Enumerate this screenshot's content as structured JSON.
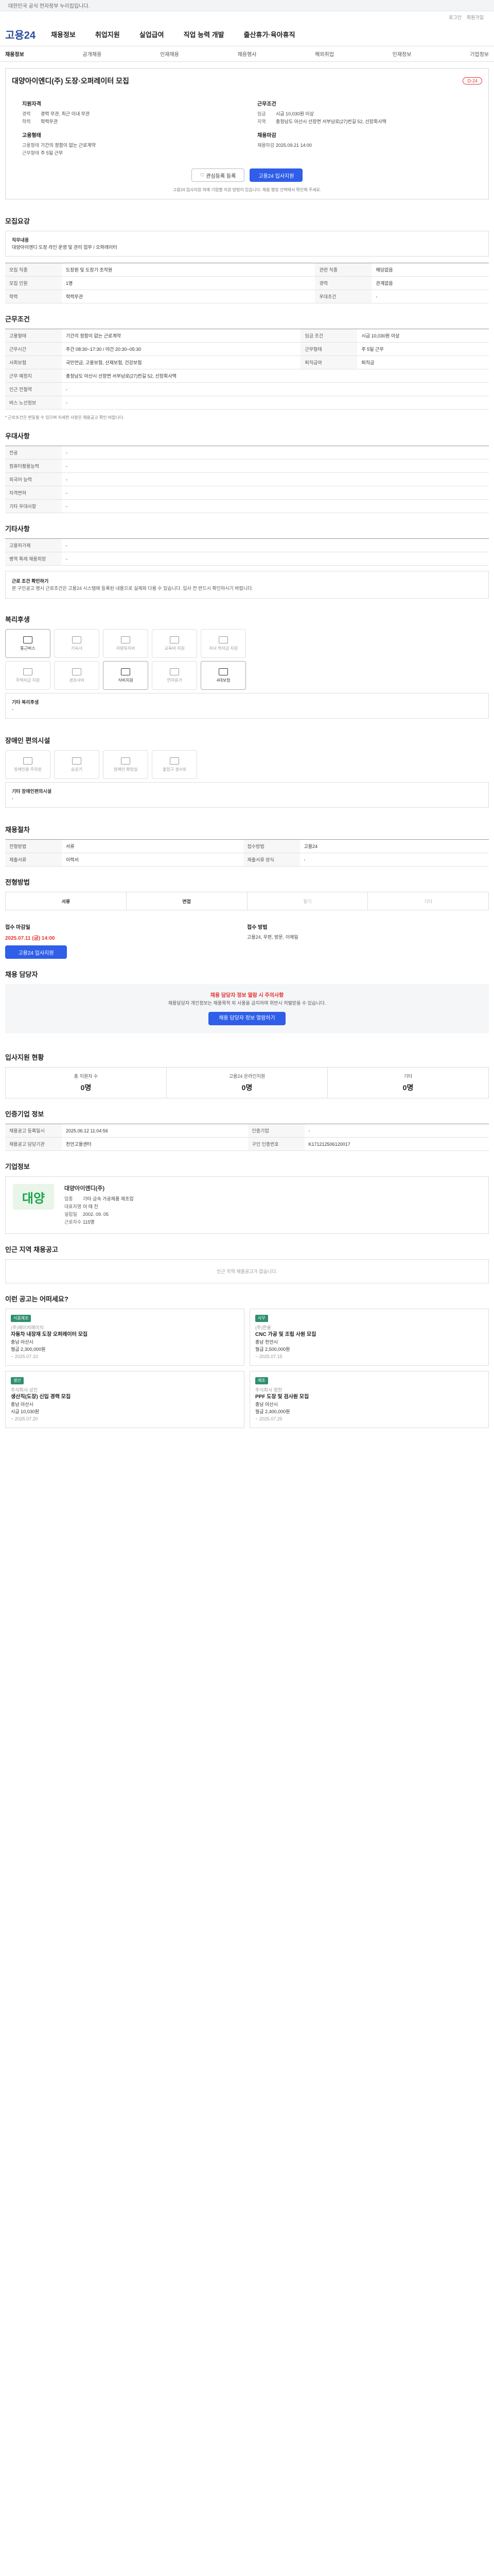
{
  "topbar": "대한민국 공식 전자정부 누리집입니다.",
  "util": [
    "로그인",
    "회원가입"
  ],
  "logo": "고용24",
  "gnb": [
    "채용정보",
    "취업지원",
    "실업급여",
    "직업 능력 개발",
    "출산휴가·육아휴직"
  ],
  "lnb": [
    "채용정보",
    "공개채용",
    "인재채용",
    "채용행사",
    "해외취업",
    "인재정보",
    "기업정보"
  ],
  "job": {
    "title": "대양아이엔디(주) 도장·오퍼레이터 모집",
    "dday": "D-24",
    "left_head": "지원자격",
    "left": [
      [
        "경력",
        "경력 무관, 최근 이내 무관"
      ],
      [
        "학력",
        "학력무관"
      ]
    ],
    "right_head": "근무조건",
    "right": [
      [
        "임금",
        "시급 10,030원 이상"
      ],
      [
        "지역",
        "충청남도 아산시 선장면 서부남로(27)번길 52, 선장회사택"
      ]
    ],
    "left_head2": "고용형태",
    "left2": [
      [
        "고용형태",
        "기간의 정함이 없는 근로계약"
      ],
      [
        "근무형태",
        "주 5일 근무"
      ]
    ],
    "right_head2": "채용마감",
    "right2": [
      [
        "채용마감",
        "2025.09.21 14:00"
      ]
    ],
    "btn_save": "관심등록 등록",
    "btn_apply": "고용24 입사지원",
    "note": "고용24 입사지원 외에 기업별 지원 방법이 있습니다. 채용 행정 선택에서 확인해 주세요."
  },
  "t1": "모집요강",
  "field_label": "직무내용",
  "field_text": "대양아이엔디 도장 라인 운영 및 관리 업무 / 오퍼레이터",
  "recruit": [
    [
      "모집 직종",
      "도장원 및 도장기 조작원"
    ],
    [
      "관련 직종",
      "해당없음"
    ],
    [
      "모집 인원",
      "1명"
    ],
    [
      "경력",
      "관계없음"
    ],
    [
      "학력",
      "학력무관"
    ],
    [
      "우대조건",
      "-"
    ]
  ],
  "t2": "근무조건",
  "cond": [
    [
      "고용형태",
      "기간의 정함이 없는 근로계약"
    ],
    [
      "임금 조건",
      "시급 10,030원 이상"
    ],
    [
      "근무시간",
      "주간 08:30~17:30 / 야간 20:30~05:30"
    ],
    [
      "근무형태",
      "주 5일 근무"
    ],
    [
      "사회보험",
      "국민연금, 고용보험, 산재보험, 건강보험"
    ],
    [
      "퇴직급여",
      "퇴직금"
    ],
    [
      "근무 예정지",
      "충청남도 아산시 선장면 서부남로(27)번길 52, 선장회사택"
    ],
    [
      "인근 전철역",
      "-"
    ],
    [
      "버스 노선정보",
      "-"
    ]
  ],
  "cond_note": "* 근로조건은 변동될 수 있으며 자세한 사항은 채용공고 확인 바랍니다.",
  "t3": "우대사항",
  "pref": [
    [
      "전공",
      "-"
    ],
    [
      "컴퓨터활용능력",
      "-"
    ],
    [
      "외국어 능력",
      "-"
    ],
    [
      "자격면허",
      "-"
    ],
    [
      "기타 우대사항",
      "-"
    ]
  ],
  "t4": "기타사항",
  "etc": [
    [
      "고용허가제",
      "-"
    ],
    [
      "병역 특례 채용희망",
      "-"
    ]
  ],
  "notice_title": "근로 조건 확인하기",
  "notice": "본 구인공고 명시 근로조건은 고용24 시스템에 등록된 내용으로 실제와 다를 수 있습니다. 입사 전 반드시 확인하시기 바랍니다.",
  "t5": "복리후생",
  "welfare": [
    "통근버스",
    "기숙사",
    "차량유지비",
    "교육비 지원",
    "자녀 학자금 지원",
    "주택자금 지원",
    "경조사비",
    "식비지원",
    "연차휴가",
    "4대보험"
  ],
  "welfare_etc_label": "기타 복리후생",
  "welfare_etc": "-",
  "t6": "장애인 편의시설",
  "access": [
    "장애인용 주차장",
    "승강기",
    "장애인 화장실",
    "출입구 경사로"
  ],
  "access_etc_label": "기타 장애인편의시설",
  "access_etc": "-",
  "t7": "채용절차",
  "proc": [
    [
      "전형방법",
      "서류"
    ],
    [
      "접수방법",
      "고용24"
    ],
    [
      "제출서류",
      "이력서"
    ],
    [
      "제출서류 양식",
      "-"
    ]
  ],
  "t8": "전형방법",
  "steps": [
    "서류",
    "면접",
    "필기",
    "기타"
  ],
  "deadline_label": "접수 마감일",
  "deadline": "2025.07.11 (금) 14:00",
  "apply_label": "접수 방법",
  "apply_methods": "고용24, 우편, 방문, 이메일",
  "t9": "채용 담당자",
  "warn_red": "채용 담당자 정보 열람 시 주의사항",
  "warn": "채용담당자 개인정보는 채용목적 외 사용을 금지하며 위반시 처벌받을 수 있습니다.",
  "warn_btn": "채용 담당자 정보 열람하기",
  "t10": "입사지원 현황",
  "stat": [
    [
      "총 지원자 수",
      "0명"
    ],
    [
      "고용24 온라인지원",
      "0명"
    ],
    [
      "기타",
      "0명"
    ]
  ],
  "t11": "인증기업 정보",
  "cert": [
    [
      "채용공고 등록일시",
      "2025.06.12 11:04:56"
    ],
    [
      "인증기업",
      "-"
    ],
    [
      "채용공고 담당기관",
      "천안고용센터"
    ],
    [
      "구인 인증번호",
      "K171212506120017"
    ]
  ],
  "t12": "기업정보",
  "company_logo": "대양",
  "company_name": "대양아이엔디(주)",
  "company": [
    [
      "업종",
      "기타 금속 가공제품 제조업"
    ],
    [
      "대표자명",
      "이 태 진"
    ],
    [
      "설립일",
      "2002. 09. 05"
    ],
    [
      "근로자수",
      "115명"
    ]
  ],
  "t13": "인근 지역 채용공고",
  "nearby_empty": "인근 지역 채용공고가 없습니다.",
  "t14": "이런 공고는 어떠세요?",
  "cards": [
    {
      "tag": "식품제조",
      "co": "(주)에이치에이치",
      "title": "자동차 내장재 도장 오퍼레이터 모집",
      "loc": "충남 아산시",
      "pay": "월급 2,300,000원",
      "date": "~ 2025.07.10"
    },
    {
      "tag": "사무",
      "co": "(주)한울",
      "title": "CNC 가공 및 조립 사원 모집",
      "loc": "충남 천안시",
      "pay": "월급 2,500,000원",
      "date": "~ 2025.07.15"
    },
    {
      "tag": "생산",
      "co": "주식회사 상진",
      "title": "생산직(도장) 신입 경력 모집",
      "loc": "충남 아산시",
      "pay": "시급 10,030원",
      "date": "~ 2025.07.20"
    },
    {
      "tag": "제조",
      "co": "주식회사 정한",
      "title": "PPF 도장 및 검사원 모집",
      "loc": "충남 아산시",
      "pay": "월급 2,400,000원",
      "date": "~ 2025.07.25"
    }
  ]
}
